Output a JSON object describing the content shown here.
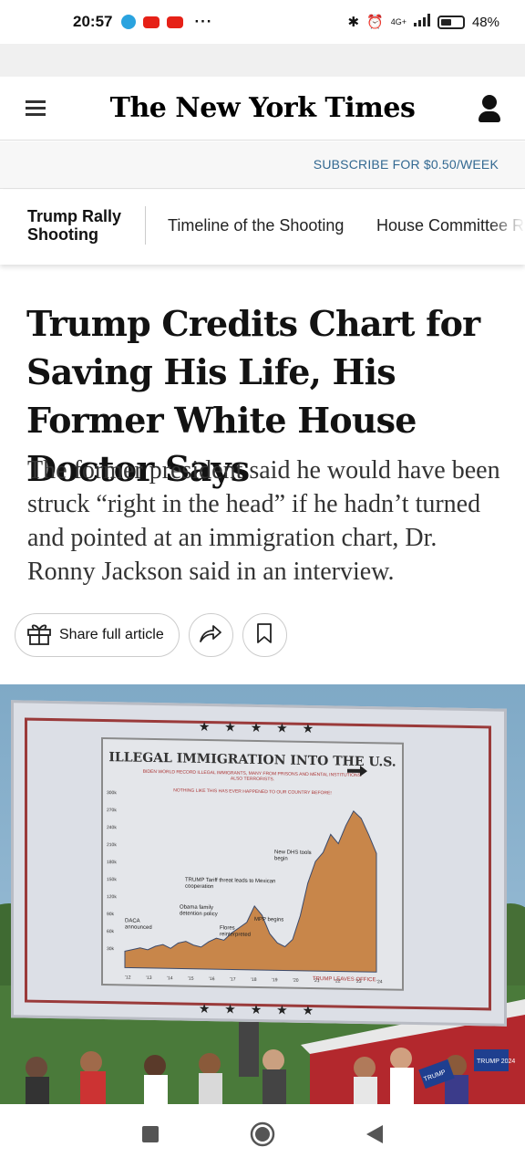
{
  "status_bar": {
    "time": "20:57",
    "network": "4G+",
    "battery_percent": "48%",
    "battery_level": 0.48,
    "more": "···"
  },
  "masthead": {
    "logo": "The New York Times",
    "menu_icon": "hamburger-menu-icon",
    "account_icon": "account-icon"
  },
  "subscribe": {
    "label": "SUBSCRIBE FOR $0.50/WEEK"
  },
  "topic_nav": {
    "label": "Trump Rally Shooting",
    "links": [
      "Timeline of the Shooting",
      "House Committee R"
    ]
  },
  "article": {
    "headline": "Trump Credits Chart for Saving His Life, His Former White House Doctor Says",
    "summary": "The former president said he would have been struck “right in the head” if he hadn’t turned and pointed at an immigration chart, Dr. Ronny Jackson said in an interview."
  },
  "actions": {
    "share_full_label": "Share full article",
    "gift_icon": "gift-icon",
    "share_icon": "share-arrow-icon",
    "bookmark_icon": "bookmark-icon"
  },
  "photo": {
    "stars": "★ ★ ★ ★ ★",
    "billboard_title": "ILLEGAL IMMIGRATION INTO THE U.S.",
    "billboard_subtitle": "BIDEN WORLD RECORD ILLEGAL IMMIGRANTS, MANY FROM PRISONS AND MENTAL INSTITUTIONS. ALSO TERRORISTS.",
    "billboard_note": "NOTHING LIKE THIS HAS EVER HAPPENED TO OUR COUNTRY BEFORE!",
    "y_ticks": [
      "300k",
      "270k",
      "240k",
      "210k",
      "180k",
      "150k",
      "120k",
      "90k",
      "60k",
      "30k"
    ],
    "x_ticks": [
      "'12",
      "'13",
      "'14",
      "'15",
      "'16",
      "'17",
      "'18",
      "'19",
      "'20",
      "'21",
      "'22",
      "'23",
      "'24"
    ],
    "annotations": [
      "DACA announced",
      "Obama family detention policy",
      "TRUMP Tariff threat leads to Mexican cooperation",
      "Flores reinterpreted",
      "MPP begins",
      "New DHS tools begin",
      "TRUMP LEAVES OFFICE"
    ],
    "signs": [
      "TRUMP 2024",
      "TRUMP"
    ]
  },
  "nav_bar": {
    "recents_icon": "recents-square-icon",
    "home_icon": "home-circle-icon",
    "back_icon": "back-triangle-icon"
  },
  "colors": {
    "link_blue": "#326891",
    "text": "#121212",
    "chart_red": "#9a3a3a"
  }
}
